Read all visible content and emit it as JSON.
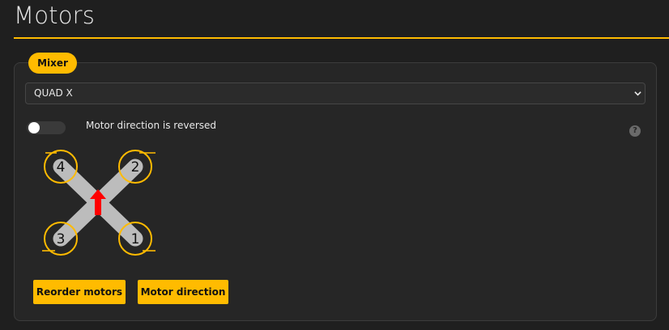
{
  "page": {
    "title": "Motors"
  },
  "mixer": {
    "tag_label": "Mixer",
    "selected_mixer": "QUAD X",
    "reversed_label": "Motor direction is reversed",
    "reversed_enabled": false,
    "help_glyph": "?"
  },
  "diagram": {
    "motors": [
      {
        "number": "4"
      },
      {
        "number": "2"
      },
      {
        "number": "3"
      },
      {
        "number": "1"
      }
    ],
    "colors": {
      "frame": "#bcbcbc",
      "ring": "#ffbb00",
      "arrow": "#ff0000"
    }
  },
  "buttons": {
    "reorder_label": "Reorder motors",
    "direction_label": "Motor direction"
  },
  "theme": {
    "accent": "#ffbb00",
    "background": "#1f1f1f",
    "panel": "#262626"
  }
}
